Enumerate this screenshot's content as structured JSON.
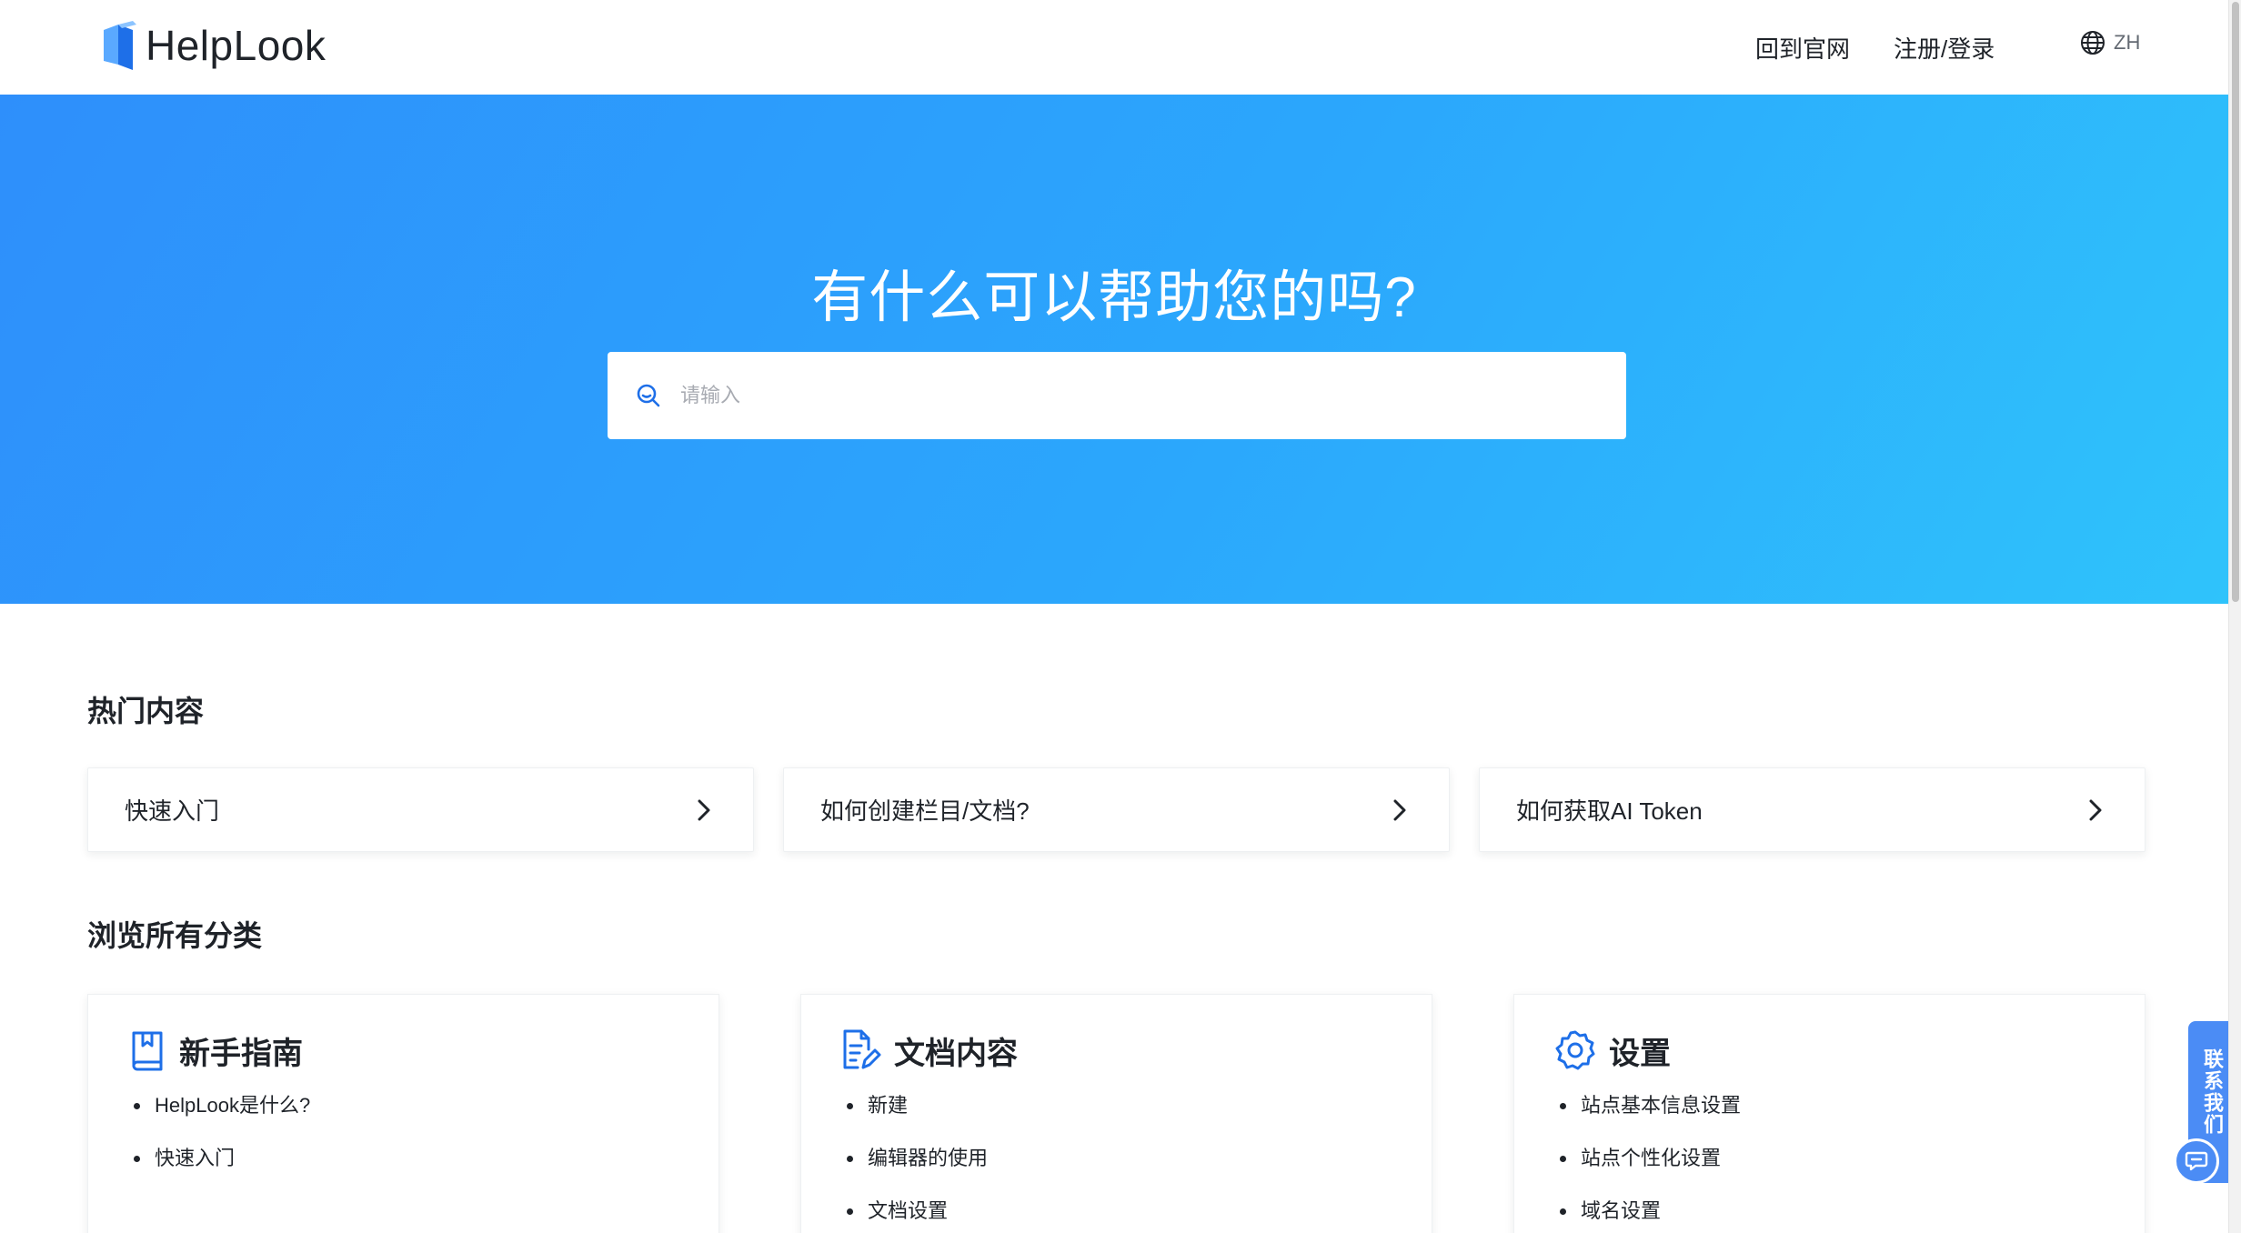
{
  "header": {
    "logo_text": "HelpLook",
    "nav": {
      "home_label": "回到官网",
      "login_label": "注册/登录"
    },
    "lang_label": "ZH"
  },
  "hero": {
    "title": "有什么可以帮助您的吗?",
    "search_placeholder": "请输入"
  },
  "hot": {
    "title": "热门内容",
    "items": [
      {
        "label": "快速入门"
      },
      {
        "label": "如何创建栏目/文档?"
      },
      {
        "label": "如何获取AI Token"
      }
    ]
  },
  "categories": {
    "title": "浏览所有分类",
    "items": [
      {
        "name": "新手指南",
        "icon": "book-icon",
        "links": [
          "HelpLook是什么?",
          "快速入门"
        ]
      },
      {
        "name": "文档内容",
        "icon": "document-edit-icon",
        "links": [
          "新建",
          "编辑器的使用",
          "文档设置"
        ]
      },
      {
        "name": "设置",
        "icon": "settings-icon",
        "links": [
          "站点基本信息设置",
          "站点个性化设置",
          "域名设置"
        ]
      }
    ]
  },
  "contact": {
    "label": "联系我们"
  },
  "colors": {
    "brand": "#2e8ffb",
    "hero_end": "#2fc3fb",
    "accent": "#4b8cf5",
    "text": "#1f2329"
  }
}
